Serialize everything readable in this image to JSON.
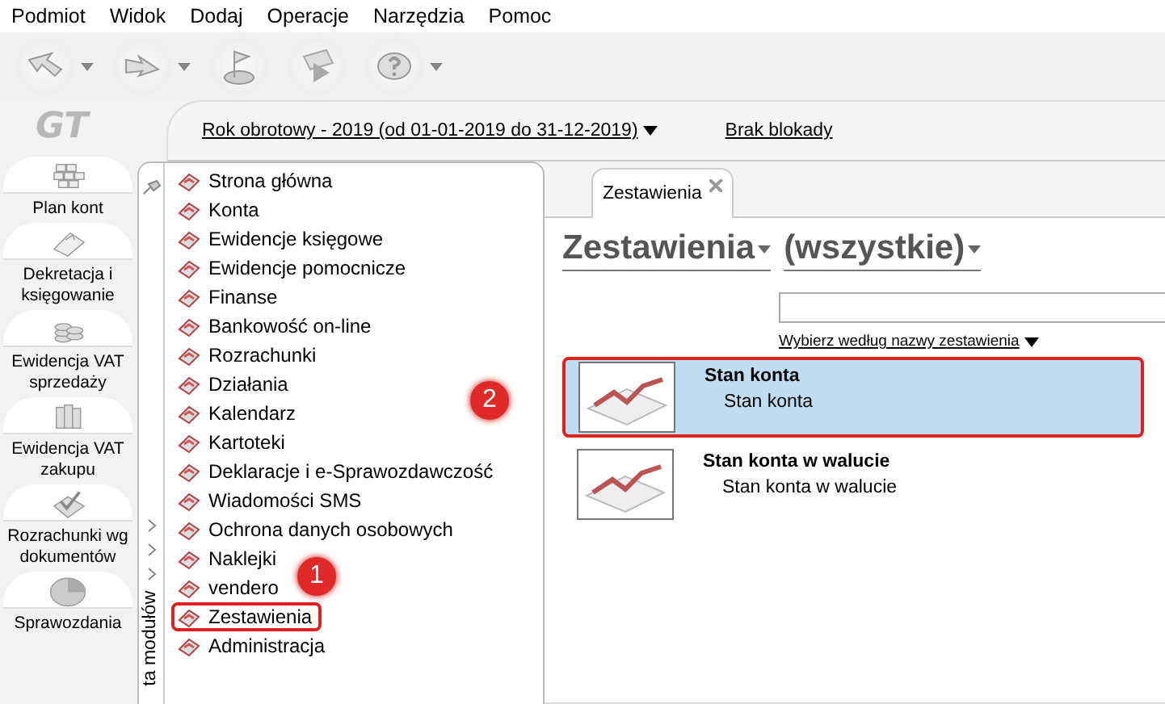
{
  "menu_bar": [
    "Podmiot",
    "Widok",
    "Dodaj",
    "Operacje",
    "Narzędzia",
    "Pomoc"
  ],
  "toolbar": [
    {
      "kind": "back",
      "has_dropdown": true
    },
    {
      "kind": "forward",
      "has_dropdown": true
    },
    {
      "kind": "flag",
      "has_dropdown": false
    },
    {
      "kind": "play",
      "has_dropdown": false
    },
    {
      "kind": "help",
      "has_dropdown": true
    }
  ],
  "logo": "GT",
  "shortcuts": [
    {
      "label": "Plan kont",
      "kind": "grid"
    },
    {
      "label": "Dekretacja i księgowanie",
      "kind": "clip"
    },
    {
      "label": "Ewidencja VAT sprzedaży",
      "kind": "coins"
    },
    {
      "label": "Ewidencja VAT zakupu",
      "kind": "books"
    },
    {
      "label": "Rozrachunki wg dokumentów",
      "kind": "check"
    },
    {
      "label": "Sprawozdania",
      "kind": "pie"
    }
  ],
  "header": {
    "fiscal_year": "Rok obrotowy - 2019  (od 01-01-2019 do 31-12-2019)",
    "lock": "Brak blokady"
  },
  "module_menu": {
    "side_label": "ta modułów",
    "items": [
      {
        "label": "Strona główna",
        "highlighted": false
      },
      {
        "label": "Konta",
        "highlighted": false
      },
      {
        "label": "Ewidencje księgowe",
        "highlighted": false
      },
      {
        "label": "Ewidencje pomocnicze",
        "highlighted": false
      },
      {
        "label": "Finanse",
        "highlighted": false
      },
      {
        "label": "Bankowość on-line",
        "highlighted": false
      },
      {
        "label": "Rozrachunki",
        "highlighted": false
      },
      {
        "label": "Działania",
        "highlighted": false
      },
      {
        "label": "Kalendarz",
        "highlighted": false
      },
      {
        "label": "Kartoteki",
        "highlighted": false
      },
      {
        "label": "Deklaracje i e-Sprawozdawczość",
        "highlighted": false
      },
      {
        "label": "Wiadomości SMS",
        "highlighted": false
      },
      {
        "label": "Ochrona danych osobowych",
        "highlighted": false
      },
      {
        "label": "Naklejki",
        "highlighted": false
      },
      {
        "label": "vendero",
        "highlighted": false
      },
      {
        "label": "Zestawienia",
        "highlighted": true
      },
      {
        "label": "Administracja",
        "highlighted": false
      }
    ]
  },
  "tabs": [
    {
      "label": "Zestawienia",
      "selected": true
    }
  ],
  "title": "Zestawienia",
  "filter": "(wszystkie)",
  "sort_link": "Wybierz według nazwy zestawienia",
  "reports": [
    {
      "title": "Stan konta",
      "subtitle": "Stan konta",
      "selected": true,
      "highlighted": true
    },
    {
      "title": "Stan konta w walucie",
      "subtitle": "Stan konta w walucie",
      "selected": false,
      "highlighted": false
    }
  ],
  "annotations": [
    "1",
    "2"
  ]
}
